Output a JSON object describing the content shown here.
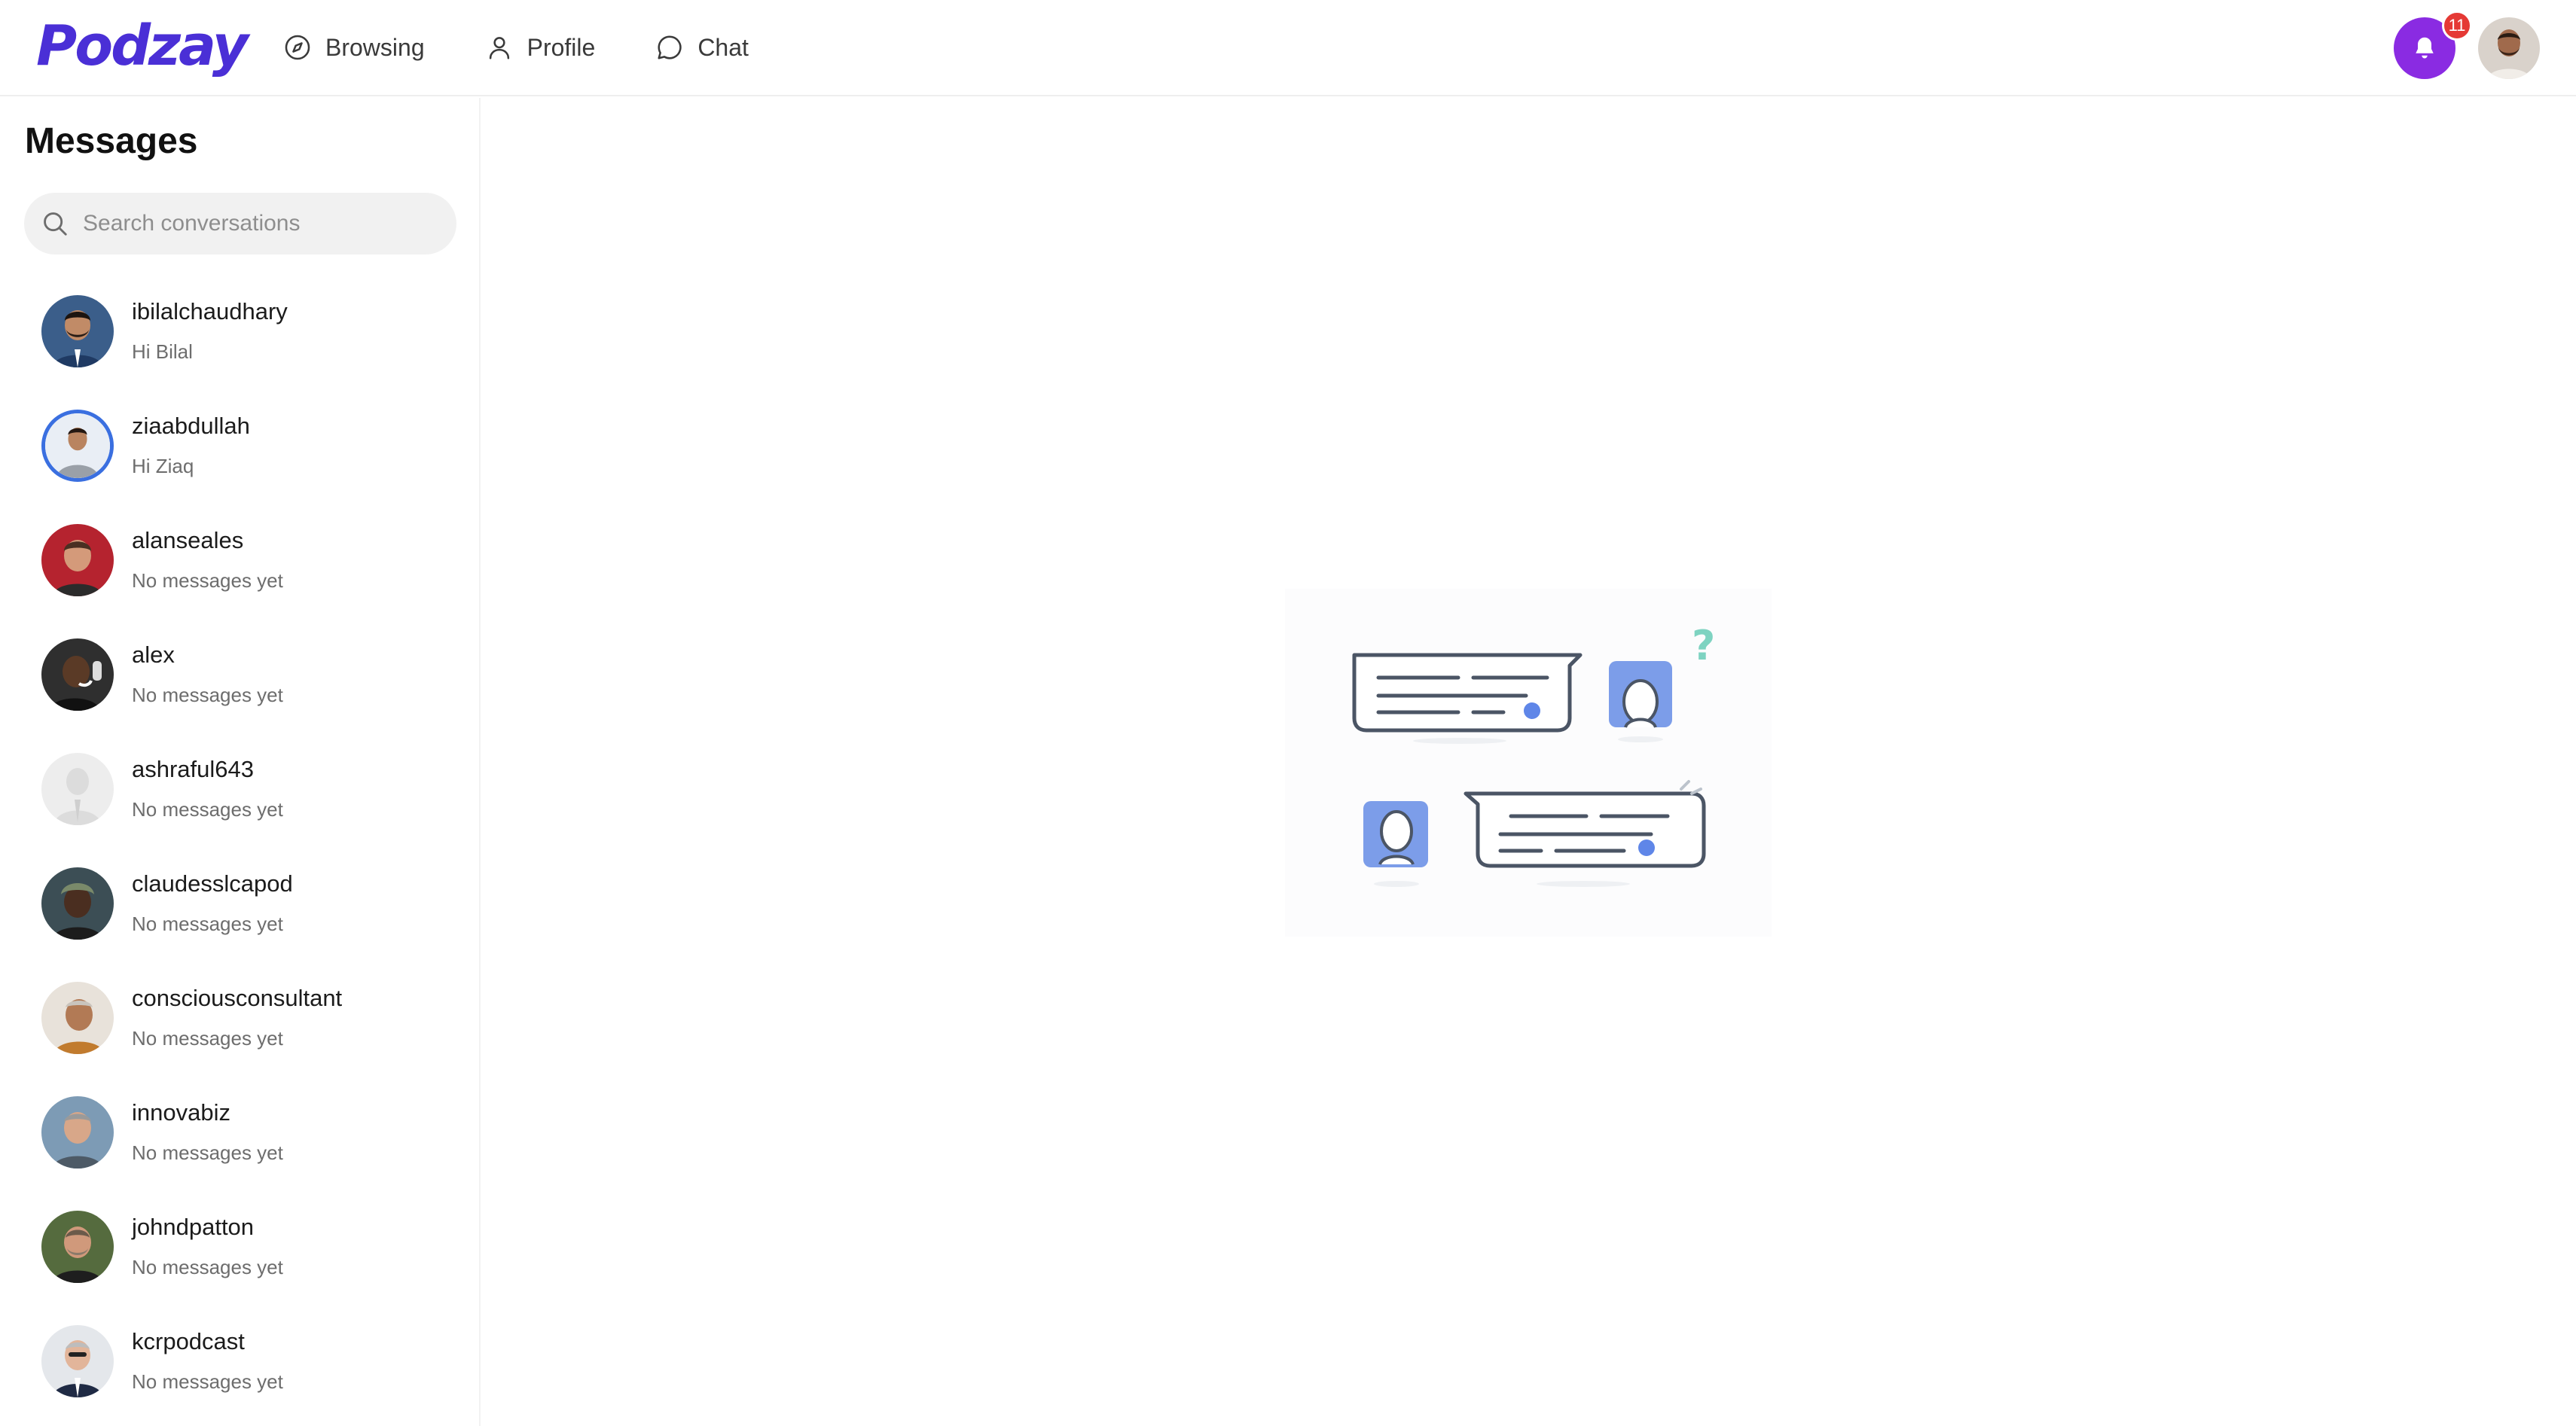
{
  "brand": {
    "logo_text": "Podzay",
    "color": "#4a2fd6"
  },
  "nav": {
    "items": [
      {
        "label": "Browsing",
        "icon": "compass-icon"
      },
      {
        "label": "Profile",
        "icon": "user-icon"
      },
      {
        "label": "Chat",
        "icon": "chat-bubble-icon"
      }
    ]
  },
  "notifications": {
    "count": "11",
    "icon": "bell-icon",
    "color": "#8a2be2"
  },
  "sidebar": {
    "title": "Messages",
    "search": {
      "placeholder": "Search conversations",
      "value": ""
    },
    "conversations": [
      {
        "name": "ibilalchaudhary",
        "preview": "Hi Bilal"
      },
      {
        "name": "ziaabdullah",
        "preview": "Hi Ziaq"
      },
      {
        "name": "alanseales",
        "preview": "No messages yet"
      },
      {
        "name": "alex",
        "preview": "No messages yet"
      },
      {
        "name": "ashraful643",
        "preview": "No messages yet"
      },
      {
        "name": "claudesslcapod",
        "preview": "No messages yet"
      },
      {
        "name": "consciousconsultant",
        "preview": "No messages yet"
      },
      {
        "name": "innovabiz",
        "preview": "No messages yet"
      },
      {
        "name": "johndpatton",
        "preview": "No messages yet"
      },
      {
        "name": "kcrpodcast",
        "preview": "No messages yet"
      }
    ]
  },
  "main": {
    "illustration": "empty-chat-illustration"
  }
}
